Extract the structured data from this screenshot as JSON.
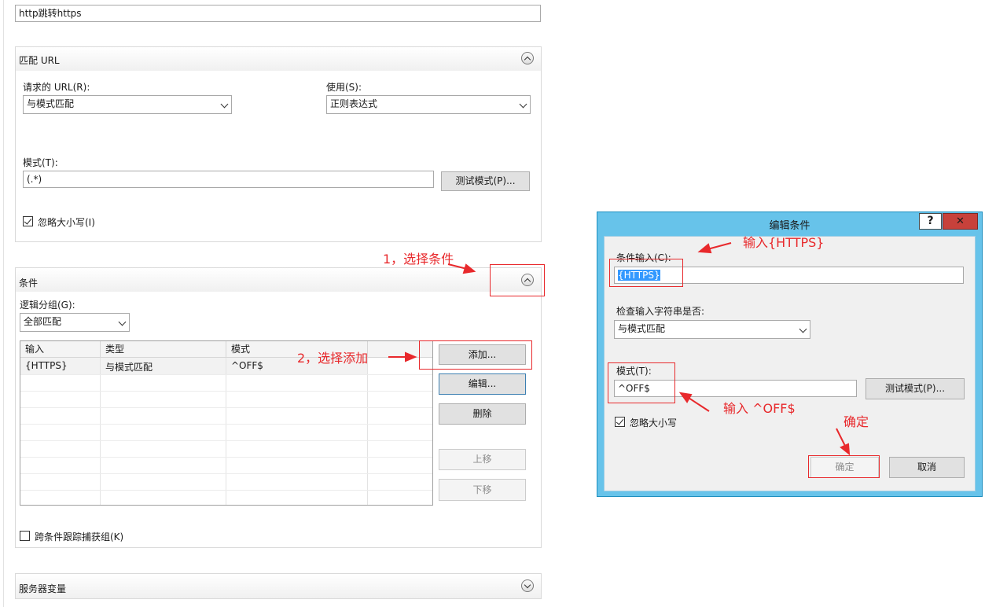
{
  "rule_name_value": "http跳转https",
  "match_url": {
    "title": "匹配 URL",
    "requested_url_label": "请求的 URL(R):",
    "requested_url_value": "与模式匹配",
    "using_label": "使用(S):",
    "using_value": "正则表达式",
    "pattern_label": "模式(T):",
    "pattern_value": "(.*)",
    "test_pattern_button": "测试模式(P)...",
    "ignore_case_label": "忽略大小写(I)",
    "ignore_case_checked": true
  },
  "conditions": {
    "title": "条件",
    "logical_grouping_label": "逻辑分组(G):",
    "logical_grouping_value": "全部匹配",
    "columns": [
      "输入",
      "类型",
      "模式"
    ],
    "rows": [
      {
        "input": "{HTTPS}",
        "type": "与模式匹配",
        "pattern": "^OFF$"
      }
    ],
    "add_button": "添加...",
    "edit_button": "编辑...",
    "delete_button": "删除",
    "move_up_button": "上移",
    "move_down_button": "下移",
    "track_captures_label": "跨条件跟踪捕获组(K)",
    "track_captures_checked": false
  },
  "server_variables": {
    "title": "服务器变量"
  },
  "dialog": {
    "title": "编辑条件",
    "help_button": "?",
    "close_button": "✕",
    "condition_input_label": "条件输入(C):",
    "condition_input_value": "{HTTPS}",
    "check_if_label": "检查输入字符串是否:",
    "check_if_value": "与模式匹配",
    "pattern_label": "模式(T):",
    "pattern_value": "^OFF$",
    "test_pattern_button": "测试模式(P)...",
    "ignore_case_label": "忽略大小写",
    "ignore_case_checked": true,
    "ok_button": "确定",
    "cancel_button": "取消"
  },
  "annotations": {
    "step1": "1，选择条件",
    "step2": "2，选择添加",
    "input_https": "输入{HTTPS}",
    "input_off": "输入 ^OFF$",
    "confirm": "确定"
  },
  "colors": {
    "annotation_red": "#e8292c",
    "dialog_frame": "#67c3ea",
    "selection_blue": "#3399ff"
  }
}
